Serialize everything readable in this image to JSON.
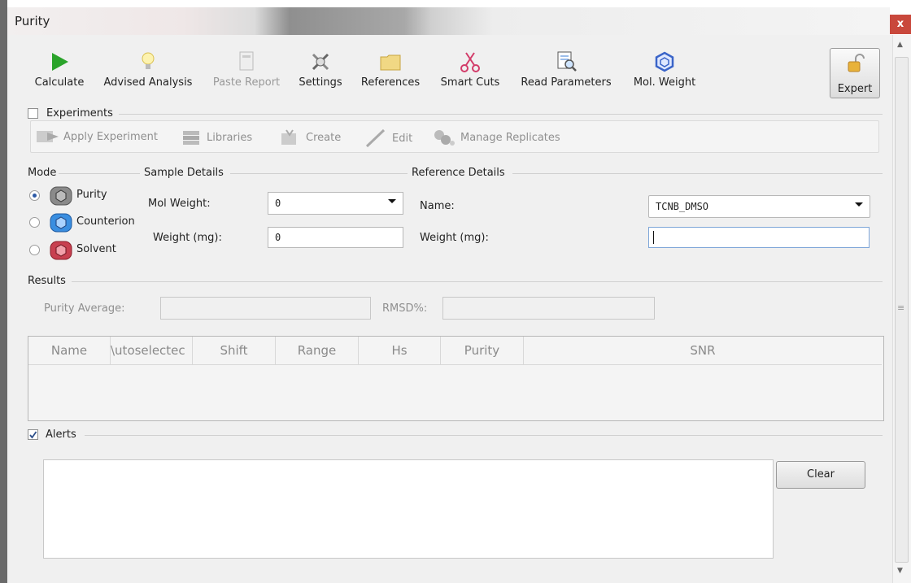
{
  "window": {
    "title": "Purity",
    "close": "x"
  },
  "toolbar": {
    "calculate": "Calculate",
    "advised": "Advised Analysis",
    "paste": "Paste Report",
    "settings": "Settings",
    "references": "References",
    "smart_cuts": "Smart Cuts",
    "read_params": "Read Parameters",
    "mol_weight": "Mol. Weight",
    "expert": "Expert"
  },
  "experiments": {
    "label": "Experiments",
    "checked": false,
    "apply": "Apply Experiment",
    "libraries": "Libraries",
    "create": "Create",
    "edit": "Edit",
    "replicates": "Manage Replicates"
  },
  "mode": {
    "label": "Mode",
    "purity": "Purity",
    "counterion": "Counterion",
    "solvent": "Solvent",
    "selected": "Purity"
  },
  "sample": {
    "label": "Sample Details",
    "mol_weight_label": "Mol Weight:",
    "mol_weight_value": "0",
    "weight_label": "Weight (mg):",
    "weight_value": "0"
  },
  "reference": {
    "label": "Reference Details",
    "name_label": "Name:",
    "name_value": "TCNB_DMSO",
    "weight_label": "Weight (mg):",
    "weight_value": ""
  },
  "results": {
    "label": "Results",
    "purity_avg_label": "Purity Average:",
    "rmsd_label": "RMSD%:",
    "columns": [
      "Name",
      "\\utoselectec",
      "Shift",
      "Range",
      "Hs",
      "Purity",
      "SNR"
    ]
  },
  "alerts": {
    "label": "Alerts",
    "checked": true,
    "clear": "Clear"
  },
  "colors": {
    "play": "#2aa32a",
    "mol_blue": "#3a64c8",
    "counter_blue": "#3a8ee0",
    "solvent_red": "#c84050"
  }
}
